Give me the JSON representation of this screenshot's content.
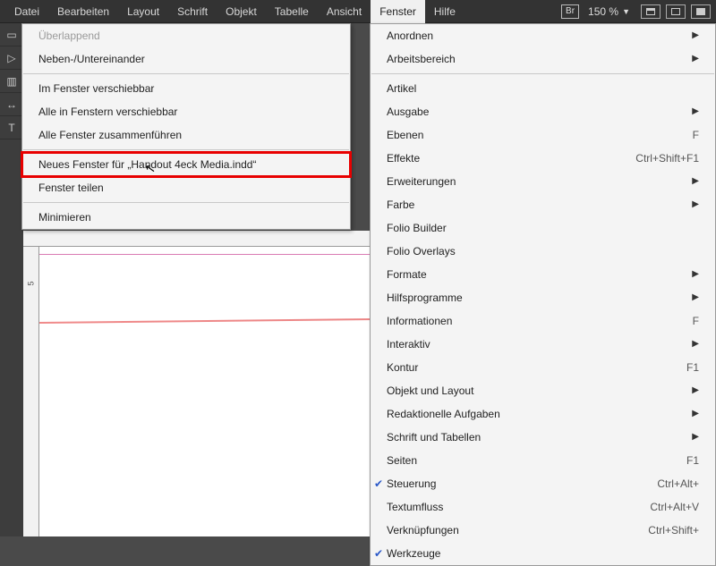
{
  "menubar": {
    "items": [
      "Datei",
      "Bearbeiten",
      "Layout",
      "Schrift",
      "Objekt",
      "Tabelle",
      "Ansicht",
      "Fenster",
      "Hilfe"
    ],
    "active_index": 7,
    "br_label": "Br",
    "zoom": "150 %"
  },
  "left_menu": {
    "items": [
      {
        "label": "Überlappend",
        "disabled": true
      },
      {
        "label": "Neben-/Untereinander"
      },
      {
        "sep": true
      },
      {
        "label": "Im Fenster verschiebbar"
      },
      {
        "label": "Alle in Fenstern verschiebbar"
      },
      {
        "label": "Alle Fenster zusammenführen"
      },
      {
        "sep": true
      },
      {
        "label": "Neues Fenster für „Handout 4eck Media.indd“",
        "highlight": true
      },
      {
        "label": "Fenster teilen"
      },
      {
        "sep": true
      },
      {
        "label": "Minimieren"
      }
    ]
  },
  "right_menu": {
    "items": [
      {
        "label": "Anordnen",
        "sub": true
      },
      {
        "label": "Arbeitsbereich",
        "sub": true
      },
      {
        "sep": true
      },
      {
        "label": "Artikel"
      },
      {
        "label": "Ausgabe",
        "sub": true
      },
      {
        "label": "Ebenen",
        "shortcut": "F"
      },
      {
        "label": "Effekte",
        "shortcut": "Ctrl+Shift+F1"
      },
      {
        "label": "Erweiterungen",
        "sub": true
      },
      {
        "label": "Farbe",
        "sub": true
      },
      {
        "label": "Folio Builder"
      },
      {
        "label": "Folio Overlays"
      },
      {
        "label": "Formate",
        "sub": true
      },
      {
        "label": "Hilfsprogramme",
        "sub": true
      },
      {
        "label": "Informationen",
        "shortcut": "F"
      },
      {
        "label": "Interaktiv",
        "sub": true
      },
      {
        "label": "Kontur",
        "shortcut": "F1"
      },
      {
        "label": "Objekt und Layout",
        "sub": true
      },
      {
        "label": "Redaktionelle Aufgaben",
        "sub": true
      },
      {
        "label": "Schrift und Tabellen",
        "sub": true
      },
      {
        "label": "Seiten",
        "shortcut": "F1"
      },
      {
        "label": "Steuerung",
        "checked": true,
        "shortcut": "Ctrl+Alt+"
      },
      {
        "label": "Textumfluss",
        "shortcut": "Ctrl+Alt+V"
      },
      {
        "label": "Verknüpfungen",
        "shortcut": "Ctrl+Shift+"
      },
      {
        "label": "Werkzeuge",
        "checked": true
      }
    ]
  },
  "ruler": {
    "v_tick": "5"
  }
}
